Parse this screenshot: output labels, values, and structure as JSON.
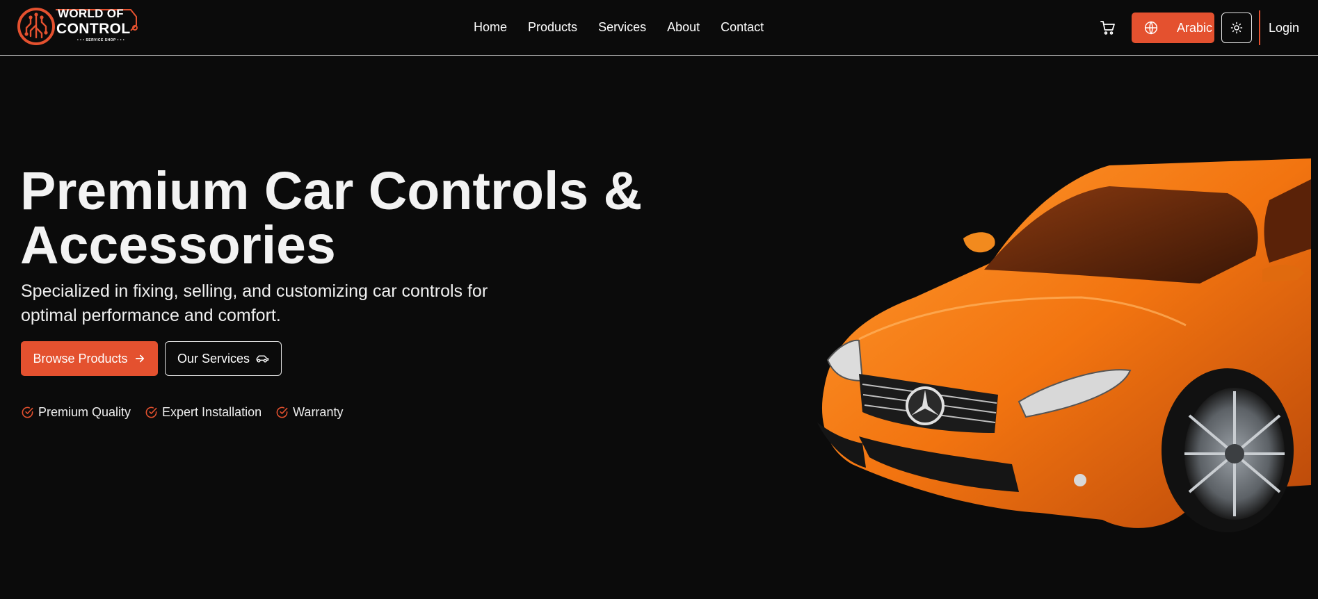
{
  "brand": {
    "line1": "WORLD OF",
    "line2": "CONTROL",
    "line3": "• • • SERVICE SHOP • • •",
    "logo_icon": "circuit-logo-icon",
    "accent_color": "#e4512f"
  },
  "nav": {
    "items": [
      {
        "label": "Home"
      },
      {
        "label": "Products"
      },
      {
        "label": "Services"
      },
      {
        "label": "About"
      },
      {
        "label": "Contact"
      }
    ]
  },
  "header_actions": {
    "cart_icon": "cart-icon",
    "language_label": "Arabic",
    "language_icon": "globe-icon",
    "theme_icon": "sun-icon",
    "login_label": "Login"
  },
  "hero": {
    "title_line1": "Premium Car Controls &",
    "title_line2": "Accessories",
    "subtitle_line1": "Specialized in fixing, selling, and customizing car controls for",
    "subtitle_line2": "optimal performance and comfort.",
    "primary_button": "Browse Products",
    "primary_button_icon": "arrow-right-icon",
    "secondary_button": "Our Services",
    "secondary_button_icon": "car-icon",
    "features": [
      {
        "label": "Premium Quality",
        "icon": "check-circle-icon"
      },
      {
        "label": "Expert Installation",
        "icon": "check-circle-icon"
      },
      {
        "label": "Warranty",
        "icon": "check-circle-icon"
      }
    ],
    "image": "orange-car-image"
  },
  "colors": {
    "background": "#0b0b0b",
    "accent": "#e4512f",
    "text": "#f2f2f2"
  }
}
